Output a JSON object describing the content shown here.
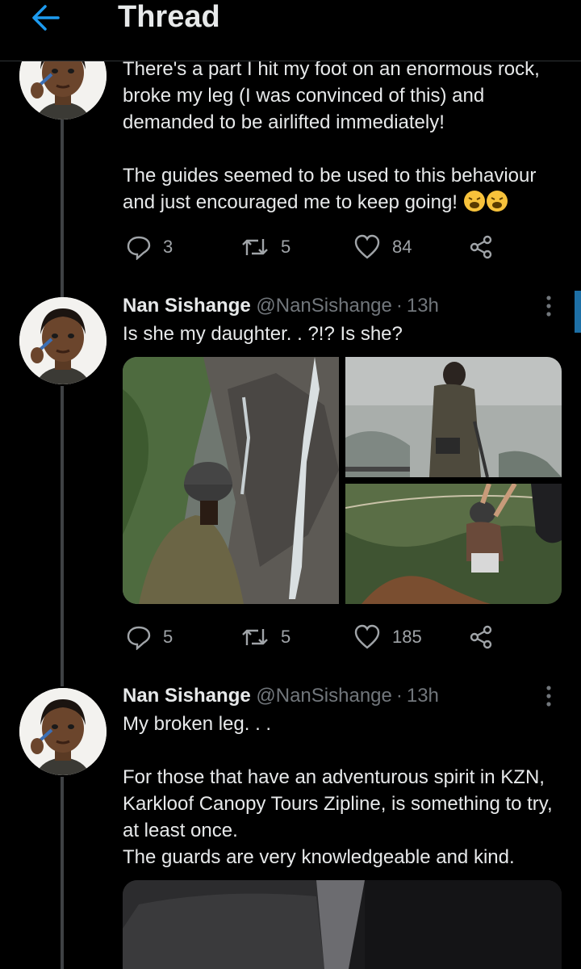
{
  "header": {
    "title": "Thread",
    "back_icon": "arrow-left-icon"
  },
  "tweets": [
    {
      "text": "There's a part I hit my foot on an enormous rock, broke my leg (I was convinced of this) and demanded to be airlifted immediately!\n\nThe guides seemed to be used to this behaviour and just encouraged me to keep going! ",
      "emoji": "weary-face-icon",
      "replies": "3",
      "retweets": "5",
      "likes": "84"
    },
    {
      "name": "Nan Sishange",
      "handle": "@NanSishange",
      "separator": "·",
      "time": "13h",
      "text": "Is she my daughter. . ?!? Is she?",
      "replies": "5",
      "retweets": "5",
      "likes": "185"
    },
    {
      "name": "Nan Sishange",
      "handle": "@NanSishange",
      "separator": "·",
      "time": "13h",
      "text": "My broken leg. . .\n\nFor those that have an adventurous spirit in KZN, Karkloof Canopy Tours Zipline, is something to try, at least once.\nThe guards are very knowledgeable and kind."
    }
  ],
  "colors": {
    "accent": "#1d9bf0",
    "background": "#000000",
    "muted": "#71767b",
    "thread_line": "#3e4144"
  }
}
